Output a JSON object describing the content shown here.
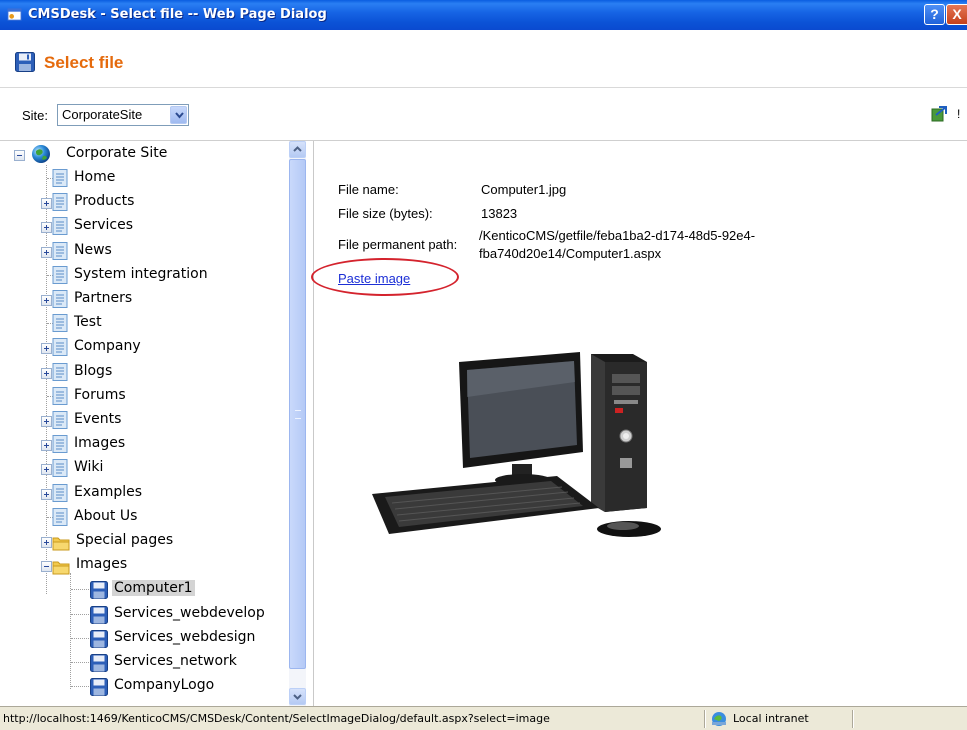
{
  "window": {
    "title": "CMSDesk - Select file -- Web Page Dialog",
    "help_btn": "?",
    "close_btn": "X"
  },
  "dialog": {
    "title": "Select file",
    "title_color": "#e56a0c"
  },
  "site": {
    "label": "Site:",
    "selected": "CorporateSite",
    "extra": "!"
  },
  "tree": {
    "root": "Corporate Site",
    "items": [
      {
        "label": "Home",
        "icon": "page-icon",
        "expandable": false
      },
      {
        "label": "Products",
        "icon": "page-icon",
        "expandable": true
      },
      {
        "label": "Services",
        "icon": "page-icon",
        "expandable": true
      },
      {
        "label": "News",
        "icon": "page-icon",
        "expandable": true
      },
      {
        "label": "System integration",
        "icon": "page-icon",
        "expandable": false
      },
      {
        "label": "Partners",
        "icon": "page-icon",
        "expandable": true
      },
      {
        "label": "Test",
        "icon": "page-icon",
        "expandable": false
      },
      {
        "label": "Company",
        "icon": "page-icon",
        "expandable": true
      },
      {
        "label": "Blogs",
        "icon": "page-icon",
        "expandable": true
      },
      {
        "label": "Forums",
        "icon": "page-icon",
        "expandable": false
      },
      {
        "label": "Events",
        "icon": "page-icon",
        "expandable": true
      },
      {
        "label": "Images",
        "icon": "page-icon",
        "expandable": true
      },
      {
        "label": "Wiki",
        "icon": "page-icon",
        "expandable": true
      },
      {
        "label": "Examples",
        "icon": "page-icon",
        "expandable": true
      },
      {
        "label": "About Us",
        "icon": "page-icon",
        "expandable": false
      },
      {
        "label": "Special pages",
        "icon": "folder-icon",
        "expandable": true
      },
      {
        "label": "Images",
        "icon": "folder-icon",
        "expandable": true,
        "expanded": true
      }
    ],
    "children": [
      {
        "label": "Computer1",
        "icon": "file-icon",
        "selected": true
      },
      {
        "label": "Services_webdevelop",
        "icon": "file-icon"
      },
      {
        "label": "Services_webdesign",
        "icon": "file-icon"
      },
      {
        "label": "Services_network",
        "icon": "file-icon"
      },
      {
        "label": "CompanyLogo",
        "icon": "file-icon"
      }
    ]
  },
  "file": {
    "name_label": "File name:",
    "name_value": "Computer1.jpg",
    "size_label": "File size (bytes):",
    "size_value": "13823",
    "path_label": "File permanent path:",
    "path_value_line1": "/KenticoCMS/getfile/feba1ba2-d174-48d5-92e4-",
    "path_value_line2": "fba740d20e14/Computer1.aspx",
    "paste_link": "Paste image"
  },
  "status": {
    "url": "http://localhost:1469/KenticoCMS/CMSDesk/Content/SelectImageDialog/default.aspx?select=image",
    "zone": "Local intranet"
  }
}
